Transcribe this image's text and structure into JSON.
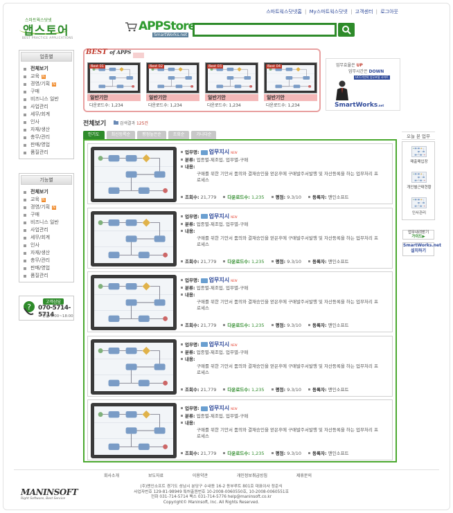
{
  "top_links": [
    "스마트웍스닷넷홈",
    "My스마트웍스닷넷",
    "고객센터",
    "로그아웃"
  ],
  "logo": {
    "small": "스마트웍스닷넷",
    "main": "앱스토어",
    "tagline": "BEST PRACTICE APPLICATIONS"
  },
  "appstore": {
    "title": "APPStore",
    "sub": "SmartWorks.net"
  },
  "search": {
    "value": ""
  },
  "side_category": {
    "header": "업종별",
    "items": [
      "전체보기",
      "교육",
      "경영/기획",
      "구매",
      "비즈니스 일반",
      "사업관리",
      "세무/회계",
      "인사",
      "자재/생산",
      "총무/관리",
      "판매/영업",
      "품질관리"
    ],
    "new_flags": [
      false,
      true,
      true,
      false,
      false,
      false,
      false,
      false,
      false,
      false,
      false,
      false
    ]
  },
  "side_function": {
    "header": "기능별",
    "items": [
      "전체보기",
      "교육",
      "경영/기획",
      "구매",
      "비즈니스 일반",
      "사업관리",
      "세무/회계",
      "인사",
      "자재/생산",
      "총무/관리",
      "판매/영업",
      "품질관리"
    ],
    "new_flags": [
      false,
      true,
      true,
      false,
      false,
      false,
      false,
      false,
      false,
      false,
      false,
      false
    ]
  },
  "customer_service": {
    "label": "고객상담",
    "phone": "070-5714-5714",
    "hours": "평일 9:00~18:00"
  },
  "best": {
    "title": "BEST",
    "title2": "of APPS",
    "items": [
      {
        "tag": "Best 01",
        "name": "일반기안",
        "downloads": "다운로드수: 1,234"
      },
      {
        "tag": "Best 02",
        "name": "일반기안",
        "downloads": "다운로드수: 1,234"
      },
      {
        "tag": "Best 03",
        "name": "일반기안",
        "downloads": "다운로드수: 1,234"
      },
      {
        "tag": "Best 04",
        "name": "일반기안",
        "downloads": "다운로드수: 1,234"
      }
    ]
  },
  "ad": {
    "line1a": "업무효율은",
    "line1b": "UP",
    "line2a": "업무시간은",
    "line2b": "DOWN",
    "line3": "UCC기반의 업무포털 사이트",
    "brand": "SmartWorks",
    "brand_suffix": ".net"
  },
  "list": {
    "title": "전체보기",
    "result_prefix": "검색결과",
    "result_count": "125건",
    "tabs": [
      "인기도",
      "최신등록순",
      "평점높은순",
      "조회순",
      "가나다순"
    ],
    "labels": {
      "name": "업무명:",
      "category": "분류:",
      "content": "내용:",
      "views": "조회수:",
      "downloads": "다운로드수:",
      "rating": "평점:",
      "registrant": "등록자:"
    },
    "items": [
      {
        "name": "업무지시",
        "new": "NEW",
        "category": "업종별-제조업, 업무별-구매",
        "content": "구매를 위한 기안서 품의와 결재승인을 얻은후에 구매발주서발행 및 자산등록을 하는 업무처리 프로세스",
        "views": "21,779",
        "downloads": "1,235",
        "rating": "9.3/10",
        "registrant": "맨인소프트"
      },
      {
        "name": "업무지시",
        "new": "NEW",
        "category": "업종별-제조업, 업무별-구매",
        "content": "구매를 위한 기안서 품의와 결재승인을 얻은후에 구매발주서발행 및 자산등록을 하는 업무처리 프로세스",
        "views": "21,779",
        "downloads": "1,235",
        "rating": "9.3/10",
        "registrant": "맨인소프트"
      },
      {
        "name": "업무지시",
        "new": "NEW",
        "category": "업종별-제조업, 업무별-구매",
        "content": "구매를 위한 기안서 품의와 결재승인을 얻은후에 구매발주서발행 및 자산등록을 하는 업무처리 프로세스",
        "views": "21,779",
        "downloads": "1,235",
        "rating": "9.3/10",
        "registrant": "맨인소프트"
      },
      {
        "name": "업무지시",
        "new": "NEW",
        "category": "업종별-제조업, 업무별-구매",
        "content": "구매를 위한 기안서 품의와 결재승인을 얻은후에 구매발주서발행 및 자산등록을 하는 업무처리 프로세스",
        "views": "21,779",
        "downloads": "1,235",
        "rating": "9.3/10",
        "registrant": "맨인소프트"
      },
      {
        "name": "업무지시",
        "new": "NEW",
        "category": "업종별-제조업, 업무별-구매",
        "content": "구매를 위한 기안서 품의와 결재승인을 얻은후에 구매발주서발행 및 자산등록을 하는 업무처리 프로세스",
        "views": "21,779",
        "downloads": "1,235",
        "rating": "9.3/10",
        "registrant": "맨인소프트"
      }
    ]
  },
  "right": {
    "title": "오늘 본 업무",
    "items": [
      "매출매입장",
      "개인별근태현황",
      "인사관리"
    ],
    "guide_top": "업무내려받기",
    "guide_bottom": "가이드▶",
    "install_top": "SmartWorks.net",
    "install_bottom": "설치하기"
  },
  "footer": {
    "nav": [
      "회사소개",
      "보도자료",
      "이용약관",
      "개인정보취급방침",
      "제휴문의"
    ],
    "address": [
      "(주)맨인소프트 경기도 성남시 분당구 수내동 16-2 동부루트 801호 대표이사 정준식",
      "사업자번호 129-81-98949 특허출원번호 10-2008-0060550호, 10-2008-0060551호",
      "전화 031-714-5714 팩스 031-714-5776 help@maninsoft.co.kr",
      "Copyright© Maninsoft, Inc. All Rights Reserved."
    ],
    "logo": "MANINSOFT",
    "logo_tagline": "Right Software, Best Service"
  },
  "colors": {
    "brand_green": "#2e8b2a",
    "accent_red": "#c0392b",
    "link_blue": "#2f4a9a"
  }
}
